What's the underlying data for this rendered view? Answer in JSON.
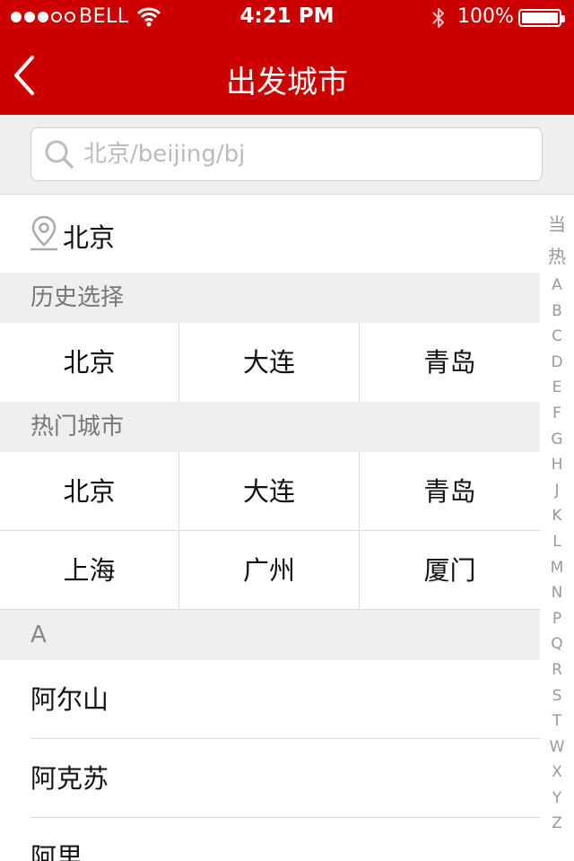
{
  "status_bar": {
    "carrier": "BELL",
    "time": "4:21 PM",
    "battery": "100%"
  },
  "nav": {
    "title": "出发城市"
  },
  "search": {
    "placeholder": "北京/beijing/bj"
  },
  "current_city": "北京",
  "history": {
    "title": "历史选择",
    "cities": [
      "北京",
      "大连",
      "青岛"
    ]
  },
  "hot": {
    "title": "热门城市",
    "cities": [
      "北京",
      "大连",
      "青岛",
      "上海",
      "广州",
      "厦门"
    ]
  },
  "section_a": {
    "letter": "A",
    "cities": [
      "阿尔山",
      "阿克苏",
      "阿里"
    ]
  },
  "index": [
    "当",
    "热",
    "A",
    "B",
    "C",
    "D",
    "E",
    "F",
    "G",
    "H",
    "J",
    "K",
    "L",
    "M",
    "N",
    "P",
    "Q",
    "R",
    "S",
    "T",
    "W",
    "X",
    "Y",
    "Z"
  ],
  "colors": {
    "brand_red": "#cc0000"
  }
}
